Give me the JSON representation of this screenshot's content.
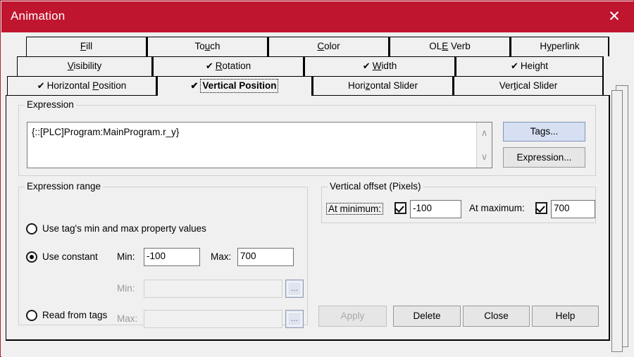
{
  "window": {
    "title": "Animation",
    "close_icon": "close-icon",
    "titlebar_color": "#c0152f",
    "border_color": "#b32033"
  },
  "tabs": {
    "row1": [
      {
        "label": "Fill",
        "mnemonic": "F",
        "checked": false,
        "selected": false
      },
      {
        "label": "Touch",
        "mnemonic": "u",
        "checked": false,
        "selected": false
      },
      {
        "label": "Color",
        "mnemonic": "C",
        "checked": false,
        "selected": false
      },
      {
        "label": "OLE Verb",
        "mnemonic": "E",
        "checked": false,
        "selected": false
      },
      {
        "label": "Hyperlink",
        "mnemonic": "y",
        "checked": false,
        "selected": false
      }
    ],
    "row2": [
      {
        "label": "Visibility",
        "mnemonic": "V",
        "checked": false,
        "selected": false
      },
      {
        "label": "Rotation",
        "mnemonic": "R",
        "checked": true,
        "selected": false
      },
      {
        "label": "Width",
        "mnemonic": "W",
        "checked": true,
        "selected": false
      },
      {
        "label": "Height",
        "mnemonic": "g",
        "checked": true,
        "selected": false
      }
    ],
    "row3": [
      {
        "label": "Horizontal Position",
        "mnemonic": "P",
        "checked": true,
        "selected": false
      },
      {
        "label": "Vertical Position",
        "mnemonic": "",
        "checked": true,
        "selected": true
      },
      {
        "label": "Horizontal Slider",
        "mnemonic": "z",
        "checked": false,
        "selected": false
      },
      {
        "label": "Vertical Slider",
        "mnemonic": "t",
        "checked": false,
        "selected": false
      }
    ],
    "check_glyph": "✔"
  },
  "expression_group": {
    "legend": "Expression",
    "value": "{::[PLC]Program:MainProgram.r_y}",
    "scroll_up_icon": "chevron-up-icon",
    "scroll_down_icon": "chevron-down-icon",
    "scroll_up_glyph": "∧",
    "scroll_down_glyph": "∨",
    "tags_button": "Tags...",
    "expression_button": "Expression..."
  },
  "expression_range": {
    "legend": "Expression range",
    "option_tag_props": "Use tag's min and max property values",
    "option_constant": "Use constant",
    "option_read_tags": "Read from tags",
    "selected_option": "Use constant",
    "const_min_label": "Min:",
    "const_min_value": "-100",
    "const_max_label": "Max:",
    "const_max_value": "700",
    "tag_min_label": "Min:",
    "tag_min_value": "",
    "tag_max_label": "Max:",
    "tag_max_value": "",
    "browse_button": "...",
    "browse_icon": "ellipsis-icon"
  },
  "vertical_offset": {
    "legend": "Vertical offset (Pixels)",
    "at_minimum_label": "At minimum:",
    "at_minimum_checked": true,
    "at_minimum_value": "-100",
    "at_maximum_label": "At maximum:",
    "at_maximum_checked": true,
    "at_maximum_value": "700"
  },
  "footer": {
    "apply": "Apply",
    "apply_enabled": false,
    "delete": "Delete",
    "close": "Close",
    "help": "Help"
  }
}
